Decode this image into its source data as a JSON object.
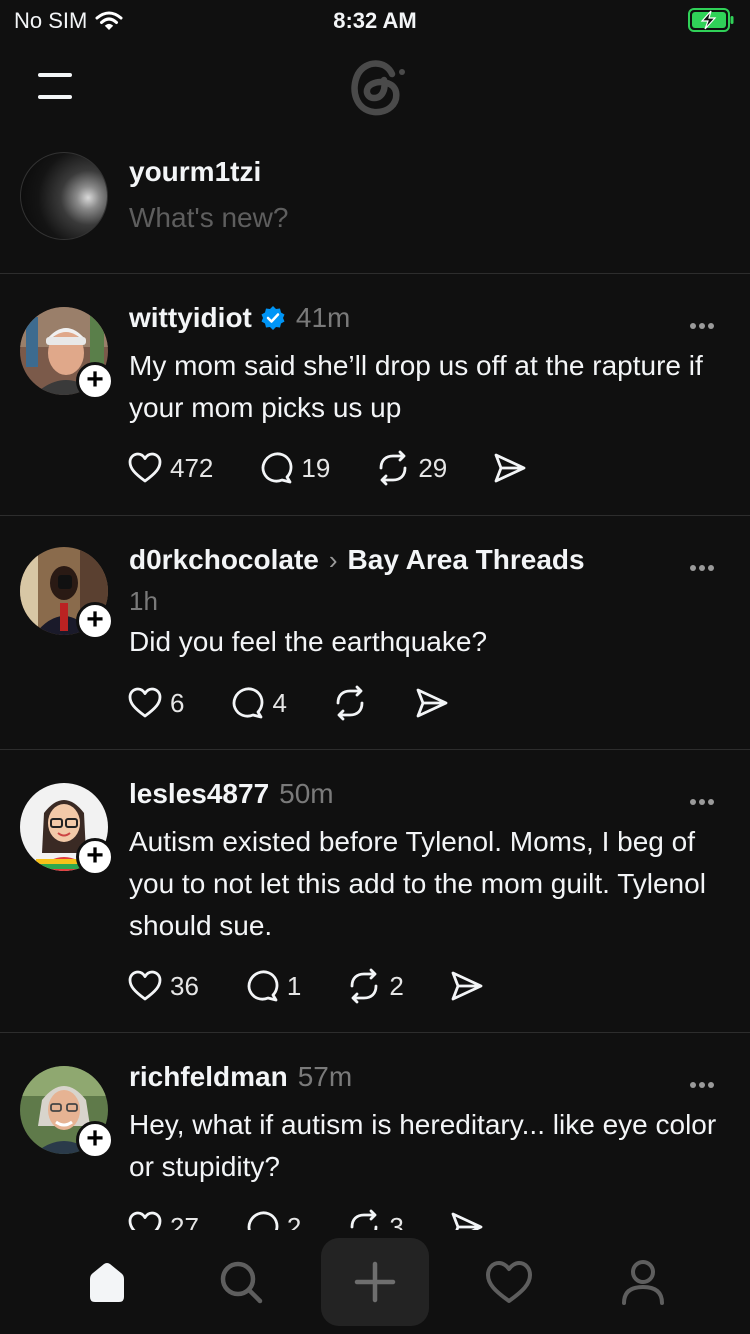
{
  "status_bar": {
    "carrier": "No SIM",
    "time": "8:32 AM"
  },
  "composer": {
    "username": "yourm1tzi",
    "placeholder": "What's new?"
  },
  "posts": [
    {
      "author": "wittyidiot",
      "verified": true,
      "time": "41m",
      "text": "My mom said she’ll drop us off at the rapture if your mom picks us up",
      "likes": "472",
      "replies": "19",
      "reposts": "29"
    },
    {
      "author": "d0rkchocolate",
      "community": "Bay Area Threads",
      "time": "1h",
      "text": "Did you feel the earthquake?",
      "likes": "6",
      "replies": "4",
      "reposts": ""
    },
    {
      "author": "lesles4877",
      "time": "50m",
      "text": "Autism existed before Tylenol. Moms, I beg of you to not let this add to the mom guilt. Tylenol should sue.",
      "likes": "36",
      "replies": "1",
      "reposts": "2"
    },
    {
      "author": "richfeldman",
      "time": "57m",
      "text": "Hey, what if autism is hereditary... like eye color or stupidity?",
      "likes": "27",
      "replies": "2",
      "reposts": "3"
    }
  ],
  "colors": {
    "background": "#101010",
    "text": "#f3f5f7",
    "muted": "#7a7a7a",
    "verified": "#0095f6",
    "battery": "#30d158"
  },
  "icons": [
    "wifi-icon",
    "battery-charging-icon",
    "menu-icon",
    "threads-logo",
    "verified-badge-icon",
    "more-icon",
    "heart-icon",
    "comment-icon",
    "repost-icon",
    "share-icon",
    "home-icon",
    "search-icon",
    "compose-icon",
    "activity-icon",
    "profile-icon"
  ]
}
